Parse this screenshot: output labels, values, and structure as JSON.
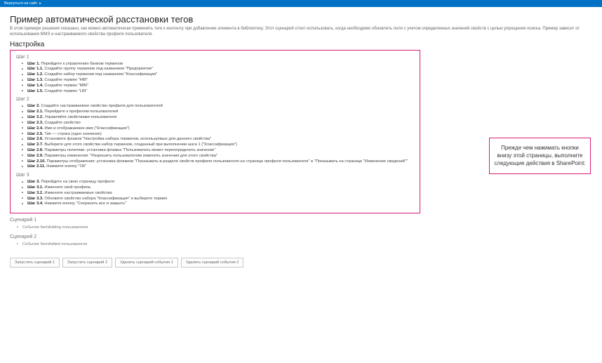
{
  "topbar": {
    "back_label": "Вернуться на сайт"
  },
  "header": {
    "title": "Пример автоматической расстановки тегов",
    "intro": "В этом примере решения показано, как можно автоматически применять теги к контенту при добавлении элемента в библиотеку. Этот сценарий стоит использовать, когда необходимо обновлять поля с учетом определенных значений свойств с целью упрощения поиска. Пример зависит от использования MMS и настраиваемого свойства профиля пользователя.",
    "setup_heading": "Настройка"
  },
  "callout": "Прежде чем нажимать кнопки внизу этой страницы, выполните следующие действия в SharePoint:",
  "steps": {
    "group1": {
      "title": "Шаг 1",
      "items": [
        {
          "b": "Шаг 1.",
          "t": " Перейдите к управлению банком терминов"
        },
        {
          "b": "Шаг 1.1.",
          "t": " Создайте группу терминов под названием \"Предприятие\""
        },
        {
          "b": "Шаг 1.2.",
          "t": " Создайте набор терминов под названием \"Классификация\""
        },
        {
          "b": "Шаг 1.3.",
          "t": " Создайте термин \"HBI\""
        },
        {
          "b": "Шаг 1.4.",
          "t": " Создайте термин \"MBI\""
        },
        {
          "b": "Шаг 1.5.",
          "t": " Создайте термин \"LBI\""
        }
      ]
    },
    "group2": {
      "title": "Шаг 2",
      "items": [
        {
          "b": "Шаг 2.",
          "t": " Создайте настраиваемое свойство профиля для пользователей"
        },
        {
          "b": "Шаг 2.1.",
          "t": " Перейдите к профилям пользователей"
        },
        {
          "b": "Шаг 2.2.",
          "t": " Управляйте свойствами пользователя"
        },
        {
          "b": "Шаг 2.3.",
          "t": " Создайте свойство"
        },
        {
          "b": "Шаг 2.4.",
          "t": " Имя и отображаемое имя (\"Классификация\")"
        },
        {
          "b": "Шаг 2.5.",
          "t": " Тип — строка (одно значение)"
        },
        {
          "b": "Шаг 2.6.",
          "t": " Установите флажок \"Настройка набора терминов, используемых для данного свойства\""
        },
        {
          "b": "Шаг 2.7.",
          "t": " Выберите для этого свойства набор терминов, созданный при выполнении шага 1 (\"Классификация\")"
        },
        {
          "b": "Шаг 2.8.",
          "t": " Параметры политики: установка флажка \"Пользователь может переопределить значение\""
        },
        {
          "b": "Шаг 2.9.",
          "t": " Параметры изменения: \"Разрешить пользователям изменять значения для этого свойства\""
        },
        {
          "b": "Шаг 2.10.",
          "t": " Параметры отображения: установка флажков \"Показывать в разделе свойств профиля пользователя на странице профиля пользователя\" и \"Показывать на странице \"Изменение сведений\"\""
        },
        {
          "b": "Шаг 2.11.",
          "t": " Нажмите кнопку \"ОК\""
        }
      ]
    },
    "group3": {
      "title": "Шаг 3",
      "items": [
        {
          "b": "Шаг 3.",
          "t": " Перейдите на свою страницу профиля"
        },
        {
          "b": "Шаг 3.1.",
          "t": " Измените свой профиль"
        },
        {
          "b": "Шаг 3.2.",
          "t": " Измените настраиваемые свойства"
        },
        {
          "b": "Шаг 3.3.",
          "t": " Обновите свойство набора \"Классификация\" и выберите термин"
        },
        {
          "b": "Шаг 3.4.",
          "t": " Нажмите кнопку \"Сохранить все и закрыть\""
        }
      ]
    }
  },
  "scenarios": {
    "s1": {
      "title": "Сценарий 1",
      "item": "Событие ItemAdding пользователя"
    },
    "s2": {
      "title": "Сценарий 2",
      "item": "Событие ItemAdded пользователя"
    }
  },
  "buttons": {
    "run1": "Запустить сценарий 1",
    "run2": "Запустить сценарий 2",
    "del1": "Удалить сценарий события 1",
    "del2": "Удалить сценарий события 2"
  }
}
